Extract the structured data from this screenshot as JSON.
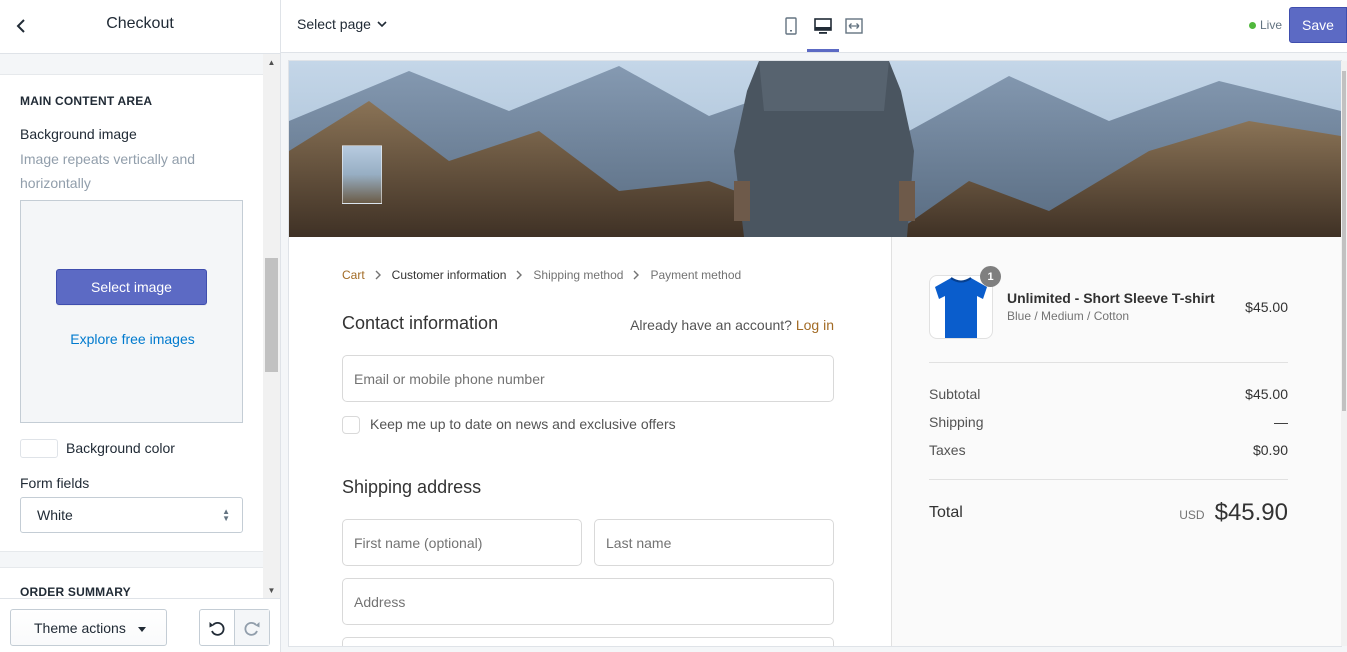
{
  "sidebar": {
    "title": "Checkout",
    "main_section_title": "MAIN CONTENT AREA",
    "background_image_label": "Background image",
    "background_image_hint": "Image repeats vertically and horizontally",
    "select_image_label": "Select image",
    "explore_free_images_label": "Explore free images",
    "background_color_label": "Background color",
    "background_color_value": "#ffffff",
    "form_fields_label": "Form fields",
    "form_fields_value": "White",
    "order_summary_title": "ORDER SUMMARY",
    "theme_actions_label": "Theme actions"
  },
  "topbar": {
    "select_page_label": "Select page",
    "devices": [
      "mobile-icon",
      "desktop-icon",
      "fullscreen-icon"
    ],
    "active_device": "desktop-icon",
    "status_label": "Live",
    "status_color": "#50b83c",
    "save_label": "Save",
    "accent_color": "#5c6ac4"
  },
  "checkout": {
    "breadcrumb": {
      "cart": "Cart",
      "customer_information": "Customer information",
      "shipping_method": "Shipping method",
      "payment_method": "Payment method"
    },
    "contact_title": "Contact information",
    "account_prompt": "Already have an account?",
    "login_label": "Log in",
    "email_placeholder": "Email or mobile phone number",
    "newsletter_label": "Keep me up to date on news and exclusive offers",
    "shipping_title": "Shipping address",
    "first_name_placeholder": "First name (optional)",
    "last_name_placeholder": "Last name",
    "address_placeholder": "Address",
    "link_color": "#a26b25"
  },
  "summary": {
    "product": {
      "name": "Unlimited - Short Sleeve T-shirt",
      "variant": "Blue / Medium / Cotton",
      "price": "$45.00",
      "quantity": "1"
    },
    "subtotal_label": "Subtotal",
    "subtotal_value": "$45.00",
    "shipping_label": "Shipping",
    "shipping_value": "—",
    "taxes_label": "Taxes",
    "taxes_value": "$0.90",
    "total_label": "Total",
    "currency": "USD",
    "total_value": "$45.90"
  }
}
